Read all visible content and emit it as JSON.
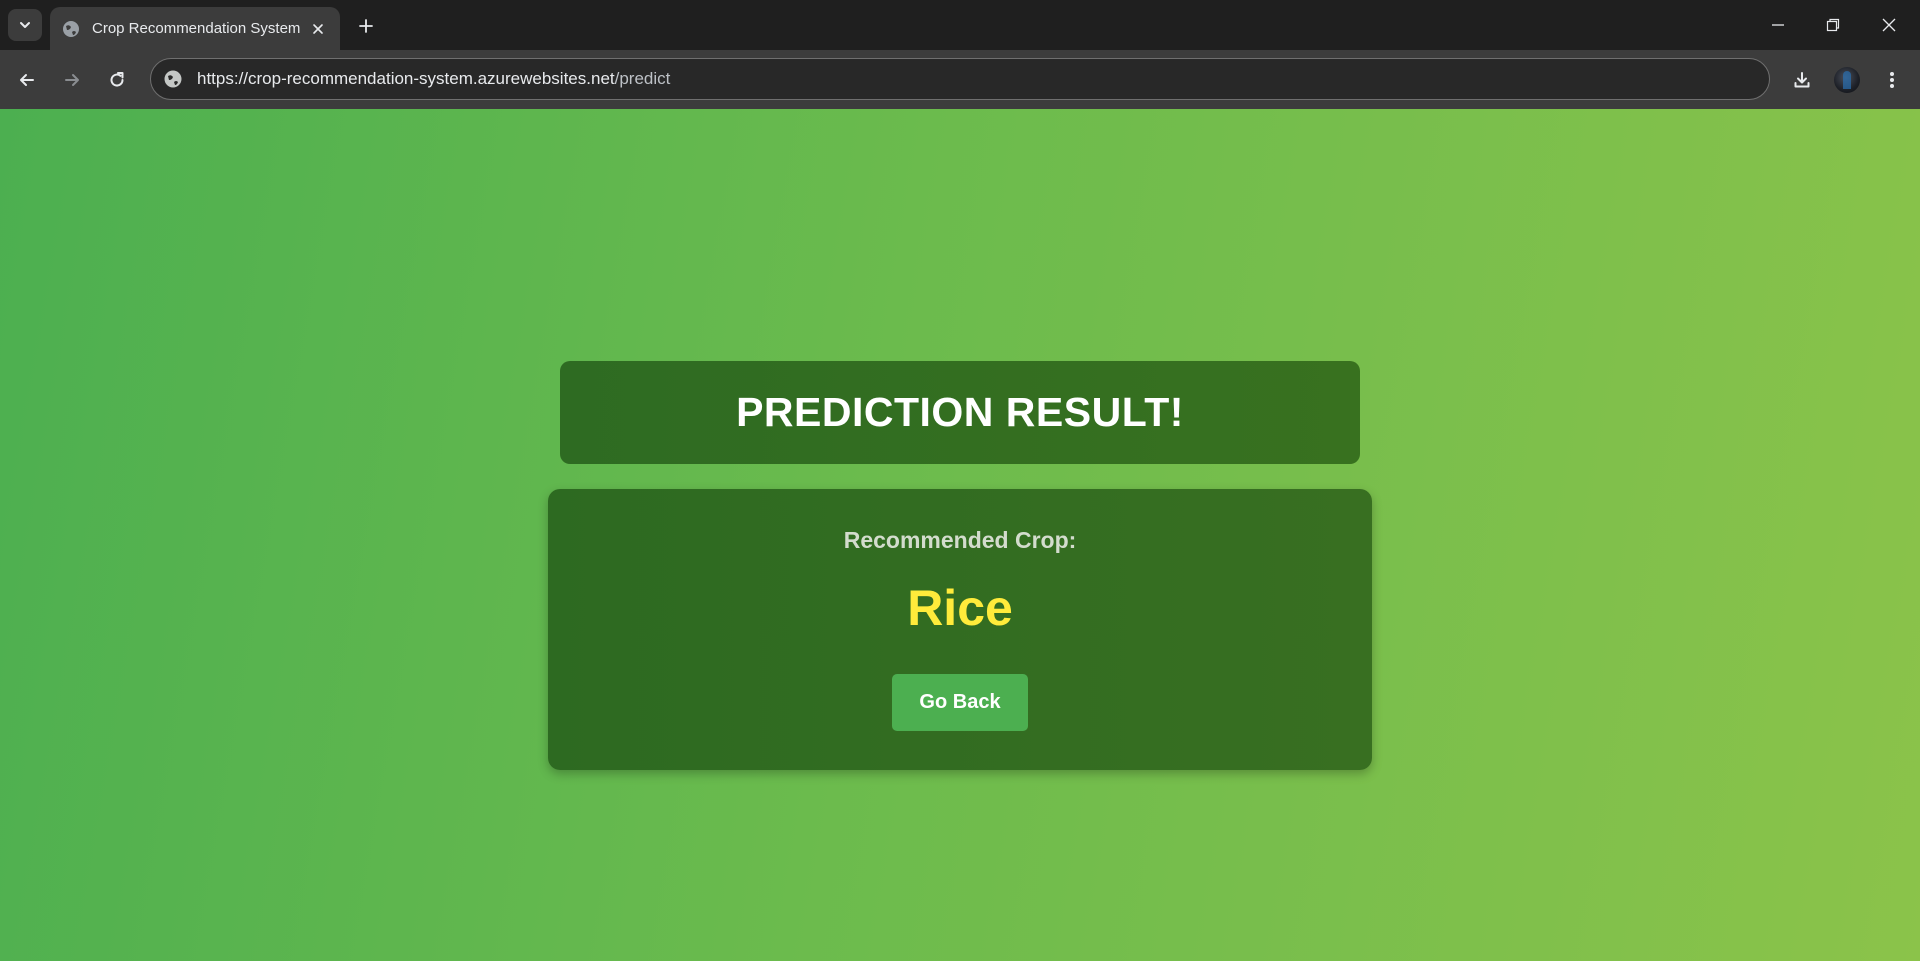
{
  "browser": {
    "tab": {
      "title": "Crop Recommendation System",
      "favicon": "globe-icon"
    },
    "url": {
      "base": "https://crop-recommendation-system.azurewebsites.net",
      "path": "/predict"
    },
    "icons": {
      "tab_search": "chevron-down-icon",
      "tab_close": "close-icon",
      "new_tab": "plus-icon",
      "minimize": "minimize-icon",
      "restore": "restore-icon",
      "close_window": "close-icon",
      "back": "arrow-left-icon",
      "forward": "arrow-right-icon",
      "reload": "reload-icon",
      "site_info": "globe-icon",
      "download": "download-icon",
      "menu": "kebab-menu-icon"
    }
  },
  "page": {
    "title": "PREDICTION RESULT!",
    "result_label": "Recommended Crop:",
    "result_value": "Rice",
    "back_button_label": "Go Back"
  },
  "colors": {
    "background_start": "#4caf50",
    "background_end": "#8bc34a",
    "card": "#2e6b22",
    "result_value": "#ffeb3b",
    "button": "#4caf50"
  }
}
